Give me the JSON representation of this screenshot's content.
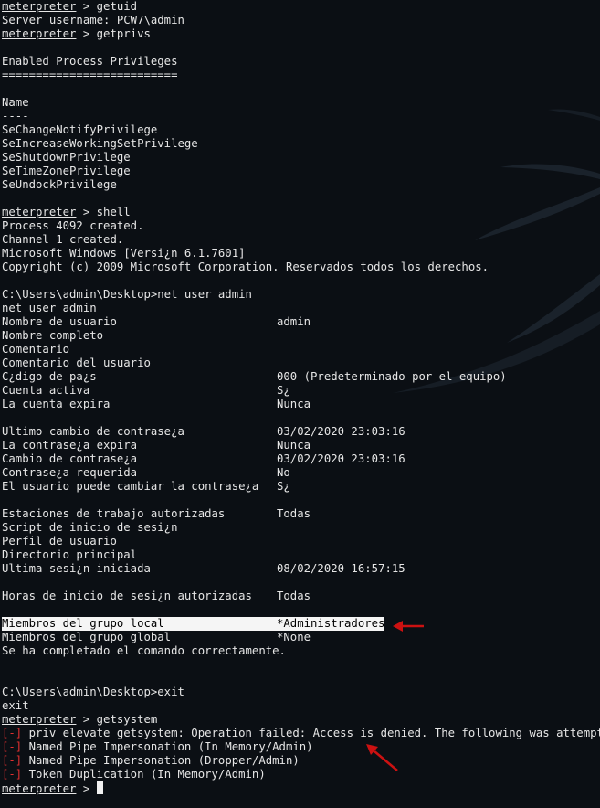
{
  "terminal": {
    "prompt": "meterpreter",
    "prompt_sep": " > ",
    "lines": [
      {
        "type": "prompt",
        "cmd": "getuid"
      },
      {
        "type": "text",
        "text": "Server username: PCW7\\admin"
      },
      {
        "type": "prompt",
        "cmd": "getprivs"
      },
      {
        "type": "blank"
      },
      {
        "type": "text",
        "text": "Enabled Process Privileges"
      },
      {
        "type": "text",
        "text": "=========================="
      },
      {
        "type": "blank"
      },
      {
        "type": "text",
        "text": "Name"
      },
      {
        "type": "text",
        "text": "----"
      },
      {
        "type": "text",
        "text": "SeChangeNotifyPrivilege"
      },
      {
        "type": "text",
        "text": "SeIncreaseWorkingSetPrivilege"
      },
      {
        "type": "text",
        "text": "SeShutdownPrivilege"
      },
      {
        "type": "text",
        "text": "SeTimeZonePrivilege"
      },
      {
        "type": "text",
        "text": "SeUndockPrivilege"
      },
      {
        "type": "blank"
      },
      {
        "type": "prompt",
        "cmd": "shell"
      },
      {
        "type": "text",
        "text": "Process 4092 created."
      },
      {
        "type": "text",
        "text": "Channel 1 created."
      },
      {
        "type": "text",
        "text": "Microsoft Windows [Versi¿n 6.1.7601]"
      },
      {
        "type": "text",
        "text": "Copyright (c) 2009 Microsoft Corporation. Reservados todos los derechos."
      },
      {
        "type": "blank"
      },
      {
        "type": "text",
        "text": "C:\\Users\\admin\\Desktop>net user admin"
      },
      {
        "type": "text",
        "text": "net user admin"
      },
      {
        "type": "kv",
        "key": "Nombre de usuario",
        "value": "admin"
      },
      {
        "type": "kv",
        "key": "Nombre completo",
        "value": ""
      },
      {
        "type": "kv",
        "key": "Comentario",
        "value": ""
      },
      {
        "type": "kv",
        "key": "Comentario del usuario",
        "value": ""
      },
      {
        "type": "kv",
        "key": "C¿digo de pa¿s",
        "value": "000 (Predeterminado por el equipo)"
      },
      {
        "type": "kv",
        "key": "Cuenta activa",
        "value": "S¿"
      },
      {
        "type": "kv",
        "key": "La cuenta expira",
        "value": "Nunca"
      },
      {
        "type": "blank"
      },
      {
        "type": "kv",
        "key": "Ultimo cambio de contrase¿a",
        "value": "03/02/2020 23:03:16"
      },
      {
        "type": "kv",
        "key": "La contrase¿a expira",
        "value": "Nunca"
      },
      {
        "type": "kv",
        "key": "Cambio de contrase¿a",
        "value": "03/02/2020 23:03:16"
      },
      {
        "type": "kv",
        "key": "Contrase¿a requerida",
        "value": "No"
      },
      {
        "type": "kv",
        "key": "El usuario puede cambiar la contrase¿a",
        "value": "S¿"
      },
      {
        "type": "blank"
      },
      {
        "type": "kv",
        "key": "Estaciones de trabajo autorizadas",
        "value": "Todas"
      },
      {
        "type": "kv",
        "key": "Script de inicio de sesi¿n",
        "value": ""
      },
      {
        "type": "kv",
        "key": "Perfil de usuario",
        "value": ""
      },
      {
        "type": "kv",
        "key": "Directorio principal",
        "value": ""
      },
      {
        "type": "kv",
        "key": "Ultima sesi¿n iniciada",
        "value": "08/02/2020 16:57:15"
      },
      {
        "type": "blank"
      },
      {
        "type": "kv",
        "key": "Horas de inicio de sesi¿n autorizadas",
        "value": "Todas"
      },
      {
        "type": "blank"
      },
      {
        "type": "kv",
        "key": "Miembros del grupo local",
        "value": "*Administradores",
        "highlight": true
      },
      {
        "type": "kv",
        "key": "Miembros del grupo global",
        "value": "*None"
      },
      {
        "type": "text",
        "text": "Se ha completado el comando correctamente."
      },
      {
        "type": "blank"
      },
      {
        "type": "blank"
      },
      {
        "type": "text",
        "text": "C:\\Users\\admin\\Desktop>exit"
      },
      {
        "type": "text",
        "text": "exit"
      },
      {
        "type": "prompt",
        "cmd": "getsystem"
      },
      {
        "type": "err",
        "tag": "[-]",
        "text": " priv_elevate_getsystem: Operation failed: Access is denied. The following was attempted:"
      },
      {
        "type": "err",
        "tag": "[-]",
        "text": " Named Pipe Impersonation (In Memory/Admin)"
      },
      {
        "type": "err",
        "tag": "[-]",
        "text": " Named Pipe Impersonation (Dropper/Admin)"
      },
      {
        "type": "err",
        "tag": "[-]",
        "text": " Token Duplication (In Memory/Admin)"
      },
      {
        "type": "cursor"
      }
    ]
  },
  "colors": {
    "background": "#0b0f14",
    "text": "#e6e6e6",
    "error": "#e03030",
    "annotation_arrow": "#cc1111",
    "highlight_bg": "#f5f5f5"
  },
  "annotations": [
    "red-arrow-left",
    "red-arrow-up-left"
  ]
}
